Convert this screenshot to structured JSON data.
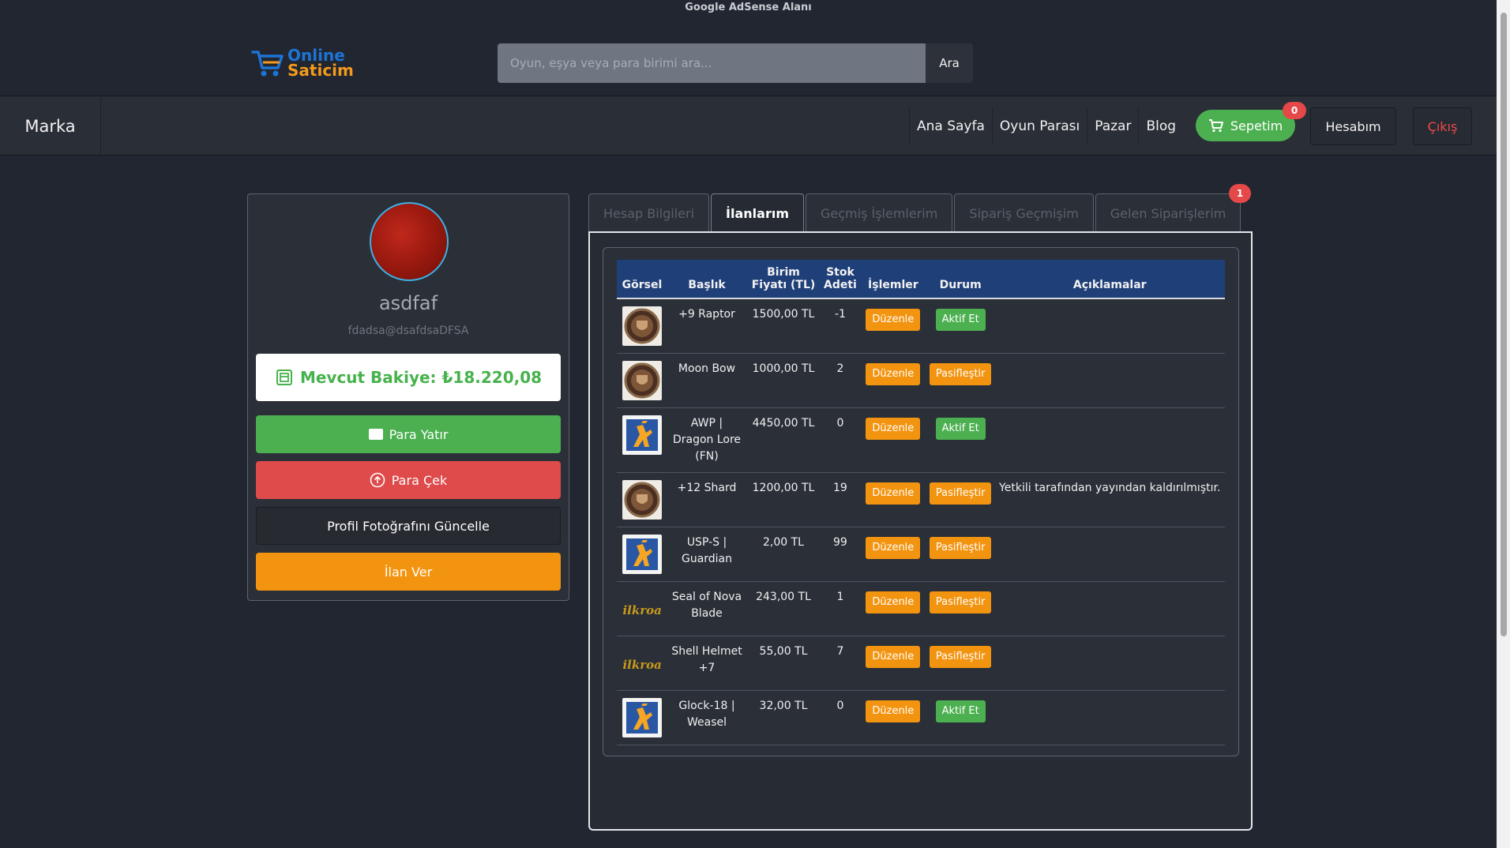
{
  "ad_banner": "Google AdSense Alanı",
  "logo": {
    "line1": "Online",
    "line2": "Saticim"
  },
  "search": {
    "placeholder": "Oyun, eşya veya para birimi ara...",
    "button": "Ara"
  },
  "nav": {
    "brand": "Marka",
    "links": [
      "Ana Sayfa",
      "Oyun Parası",
      "Pazar",
      "Blog"
    ],
    "cart_label": "Sepetim",
    "cart_count": "0",
    "account": "Hesabım",
    "logout": "Çıkış"
  },
  "profile": {
    "username": "asdfaf",
    "email": "fdadsa@dsafdsaDFSA",
    "balance": "Mevcut Bakiye: ₺18.220,08",
    "deposit": "Para Yatır",
    "withdraw": "Para Çek",
    "update_photo": "Profil Fotoğrafını Güncelle",
    "new_listing": "İlan Ver"
  },
  "tabs": [
    {
      "label": "Hesap Bilgileri"
    },
    {
      "label": "İlanlarım"
    },
    {
      "label": "Geçmiş İşlemlerim"
    },
    {
      "label": "Sipariş Geçmişim"
    },
    {
      "label": "Gelen Siparişlerim"
    }
  ],
  "tab_badge": "1",
  "table": {
    "headers": [
      "Görsel",
      "Başlık",
      "Birim Fiyatı (TL)",
      "Stok Adeti",
      "İşlemler",
      "Durum",
      "Açıklamalar"
    ],
    "edit_label": "Düzenle",
    "rows": [
      {
        "title": "+9 Raptor",
        "price": "1500,00 TL",
        "stock": "-1",
        "status": "Aktif Et",
        "status_type": "active",
        "note": "",
        "icon": "shield-game-icon"
      },
      {
        "title": "Moon Bow",
        "price": "1000,00 TL",
        "stock": "2",
        "status": "Pasifleştir",
        "status_type": "passive",
        "note": "",
        "icon": "shield-game-icon"
      },
      {
        "title": "AWP | Dragon Lore (FN)",
        "price": "4450,00 TL",
        "stock": "0",
        "status": "Aktif Et",
        "status_type": "active",
        "note": "",
        "icon": "counter-strike-icon"
      },
      {
        "title": "+12 Shard",
        "price": "1200,00 TL",
        "stock": "19",
        "status": "Pasifleştir",
        "status_type": "passive",
        "note": "Yetkili tarafından yayından kaldırılmıştır.",
        "icon": "shield-game-icon"
      },
      {
        "title": "USP-S | Guardian",
        "price": "2,00 TL",
        "stock": "99",
        "status": "Pasifleştir",
        "status_type": "passive",
        "note": "",
        "icon": "counter-strike-icon"
      },
      {
        "title": "Seal of Nova Blade",
        "price": "243,00 TL",
        "stock": "1",
        "status": "Pasifleştir",
        "status_type": "passive",
        "note": "",
        "icon": "silkroad-logo-icon"
      },
      {
        "title": "Shell Helmet +7",
        "price": "55,00 TL",
        "stock": "7",
        "status": "Pasifleştir",
        "status_type": "passive",
        "note": "",
        "icon": "silkroad-logo-icon"
      },
      {
        "title": "Glock-18 | Weasel",
        "price": "32,00 TL",
        "stock": "0",
        "status": "Aktif Et",
        "status_type": "active",
        "note": "",
        "icon": "counter-strike-icon"
      }
    ]
  }
}
